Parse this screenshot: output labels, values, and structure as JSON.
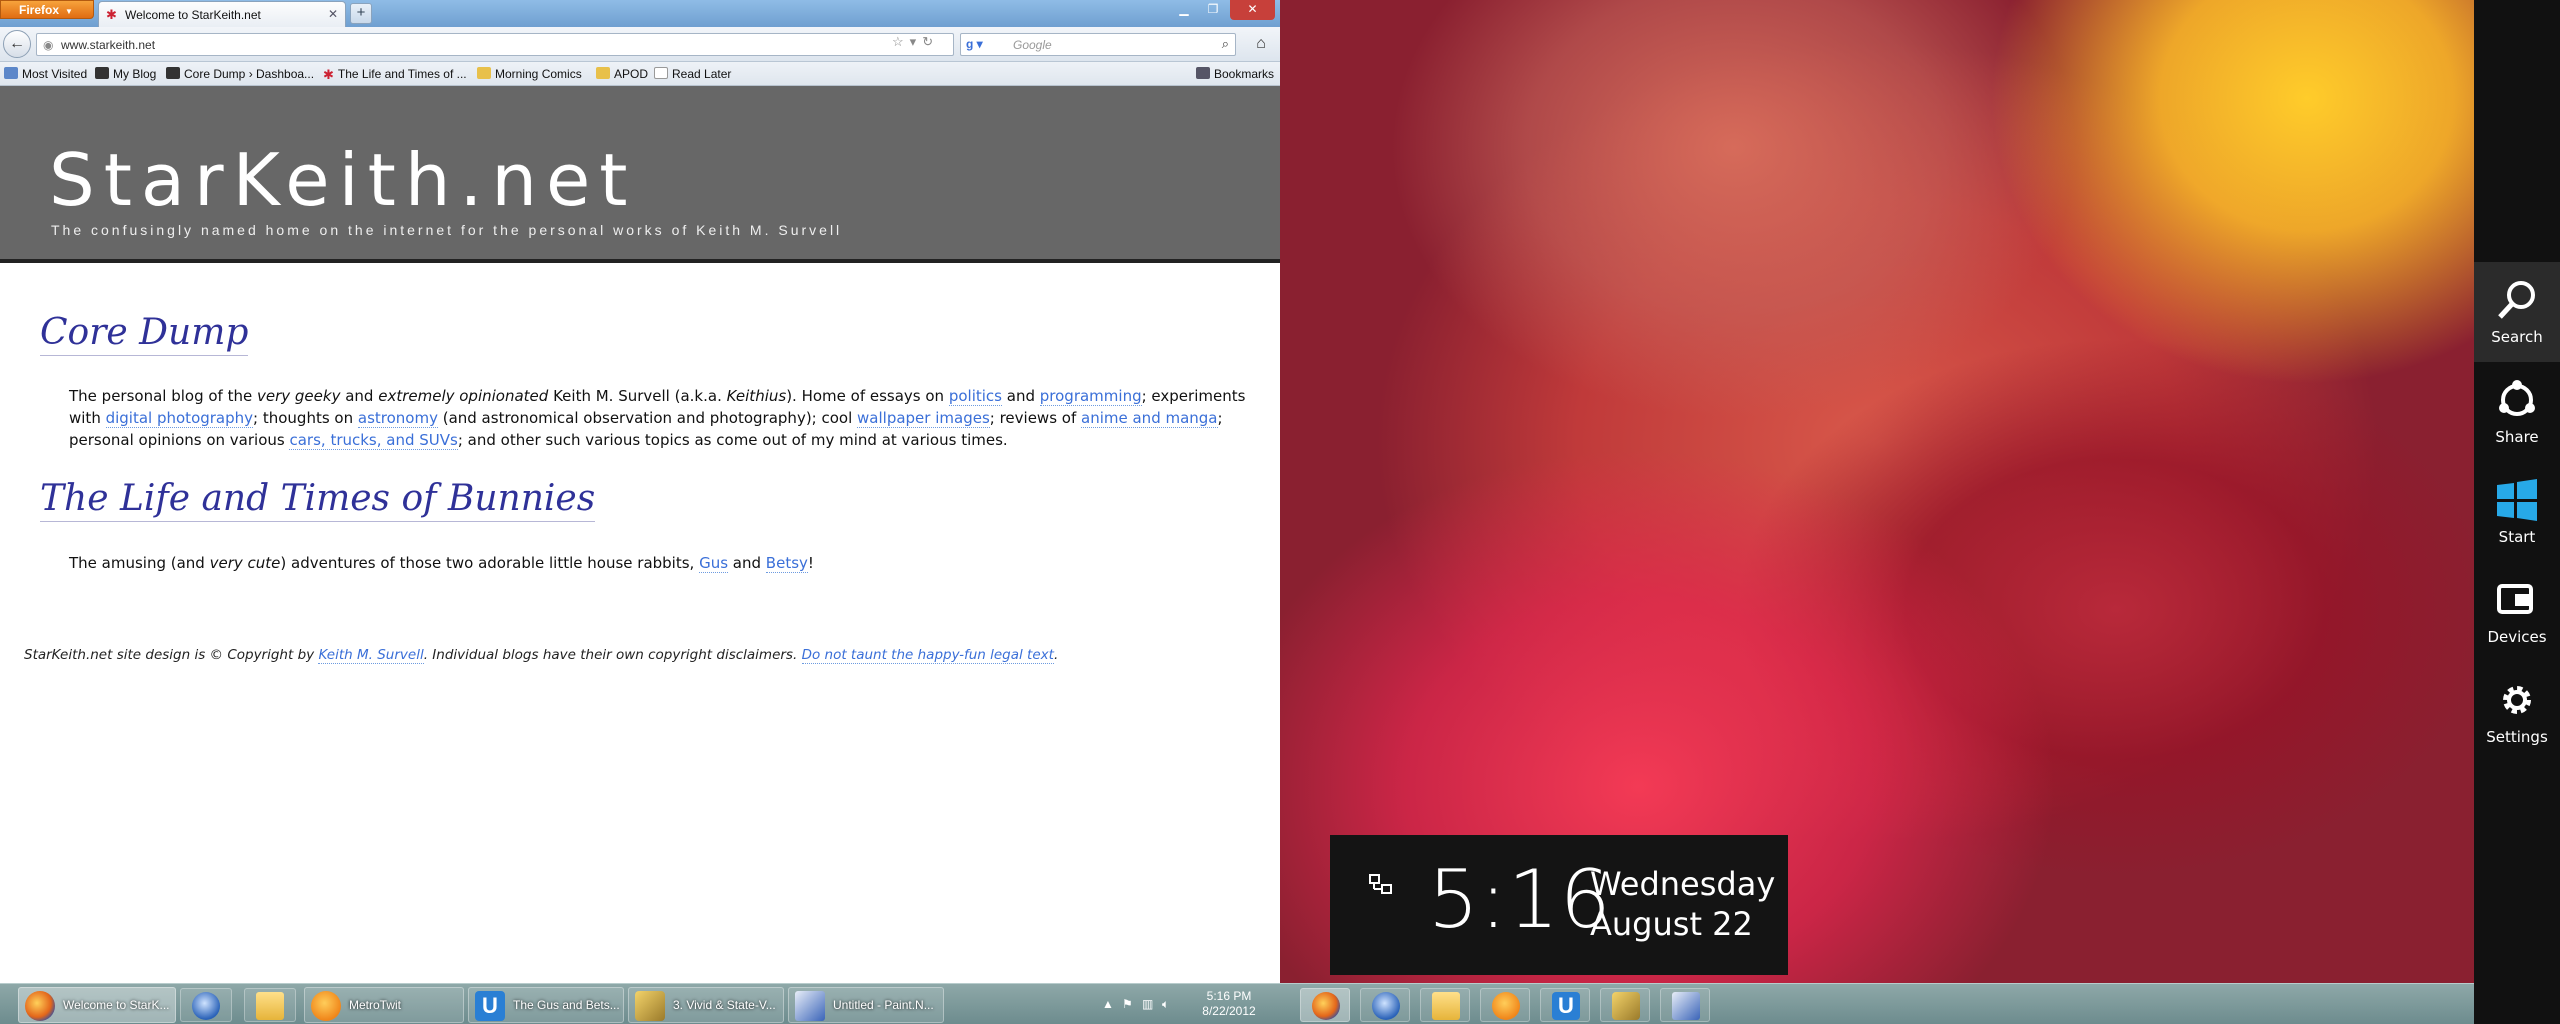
{
  "browser": {
    "app_button": "Firefox",
    "tab_title": "Welcome to StarKeith.net",
    "url": "www.starkeith.net",
    "search_placeholder": "Google",
    "bookmarks": [
      {
        "label": "Most Visited"
      },
      {
        "label": "My Blog"
      },
      {
        "label": "Core Dump › Dashboa..."
      },
      {
        "label": "The Life and Times of ..."
      },
      {
        "label": "Morning Comics"
      },
      {
        "label": "APOD"
      },
      {
        "label": "Read Later"
      }
    ],
    "bookmarks_menu": "Bookmarks"
  },
  "site": {
    "title": "StarKeith.net",
    "tagline": "The confusingly named home on the internet for the personal works of Keith M. Survell",
    "core": {
      "heading": "Core Dump",
      "t1": "The personal blog of the ",
      "em1": "very geeky",
      "t2": " and ",
      "em2": "extremely opinionated",
      "t3": " Keith M. Survell (a.k.a. ",
      "em3": "Keithius",
      "t4": "). Home of essays on ",
      "l_politics": "politics",
      "t5": " and ",
      "l_programming": "programming",
      "t6": "; experiments with ",
      "l_photo": "digital photography",
      "t7": "; thoughts on ",
      "l_astro": "astronomy",
      "t8": " (and astronomical observation and photography); cool ",
      "l_wall": "wallpaper images",
      "t9": "; reviews of ",
      "l_anime": "anime and manga",
      "t10": "; personal opinions on various ",
      "l_cars": "cars, trucks, and SUVs",
      "t11": "; and other such various topics as come out of my mind at various times."
    },
    "bunnies": {
      "heading": "The Life and Times of Bunnies",
      "t1": "The amusing (and ",
      "em1": "very cute",
      "t2": ") adventures of those two adorable little house rabbits, ",
      "l_gus": "Gus",
      "t3": " and ",
      "l_betsy": "Betsy",
      "t4": "!"
    },
    "footer": {
      "t1": "StarKeith.net site design is © Copyright by ",
      "l_author": "Keith M. Survell",
      "t2": ". Individual blogs have their own copyright disclaimers. ",
      "l_legal": "Do not taunt the happy-fun legal text",
      "t3": "."
    }
  },
  "charms": {
    "search": "Search",
    "share": "Share",
    "start": "Start",
    "devices": "Devices",
    "settings": "Settings"
  },
  "clock": {
    "time": "5:16",
    "day": "Wednesday",
    "date": "August 22"
  },
  "taskbar": {
    "items": [
      {
        "label": "Welcome to StarK..."
      },
      {
        "label": "MetroTwit"
      },
      {
        "label": "The Gus and Bets..."
      },
      {
        "label": "3. Vivid & State-V..."
      },
      {
        "label": "Untitled - Paint.N..."
      }
    ],
    "tray_time": "5:16 PM",
    "tray_date": "8/22/2012"
  },
  "colors": {
    "link": "#3a6fd8",
    "heading": "#2f3198",
    "firefox_orange": "#e06c12"
  }
}
